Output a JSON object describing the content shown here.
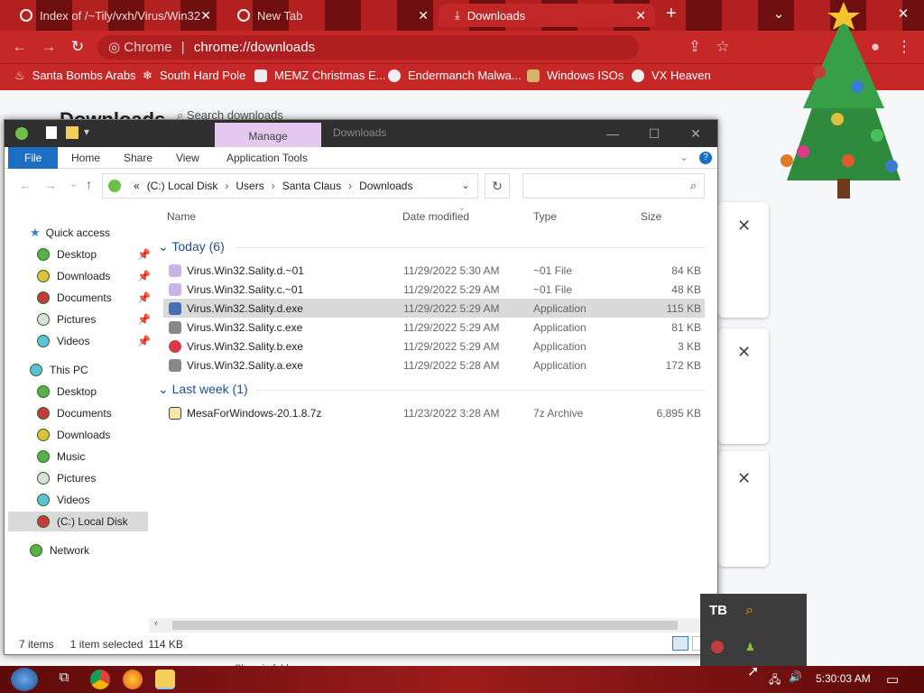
{
  "browser": {
    "tabs": [
      {
        "label": "Index of /~Tily/vxh/Virus/Win32"
      },
      {
        "label": "New Tab"
      },
      {
        "label": "Downloads"
      }
    ],
    "omnibox": {
      "site": "Chrome",
      "separator": "|",
      "url": "chrome://downloads"
    },
    "bookmarks": [
      {
        "label": "Santa Bombs Arabs"
      },
      {
        "label": "South Hard Pole"
      },
      {
        "label": "MEMZ Christmas E..."
      },
      {
        "label": "Endermanch Malwa..."
      },
      {
        "label": "Windows ISOs"
      },
      {
        "label": "VX Heaven"
      }
    ],
    "page_title": "Downloads",
    "search_placeholder": "Search downloads",
    "below_text": "Show in folder"
  },
  "explorer": {
    "manage_tab": "Manage",
    "title": "Downloads",
    "ribbon_tabs": [
      "File",
      "Home",
      "Share",
      "View",
      "Application Tools"
    ],
    "breadcrumb": [
      "«",
      "(C:) Local Disk",
      "Users",
      "Santa Claus",
      "Downloads"
    ],
    "columns": {
      "name": "Name",
      "date": "Date modified",
      "type": "Type",
      "size": "Size"
    },
    "nav": {
      "quick_access": "Quick access",
      "qa_items": [
        "Desktop",
        "Downloads",
        "Documents",
        "Pictures",
        "Videos"
      ],
      "this_pc": "This PC",
      "pc_items": [
        "Desktop",
        "Documents",
        "Downloads",
        "Music",
        "Pictures",
        "Videos",
        "(C:) Local Disk"
      ],
      "network": "Network"
    },
    "groups": [
      {
        "label": "Today (6)",
        "files": [
          {
            "name": "Virus.Win32.Sality.d.~01",
            "date": "11/29/2022 5:30 AM",
            "type": "~01 File",
            "size": "84 KB"
          },
          {
            "name": "Virus.Win32.Sality.c.~01",
            "date": "11/29/2022 5:29 AM",
            "type": "~01 File",
            "size": "48 KB"
          },
          {
            "name": "Virus.Win32.Sality.d.exe",
            "date": "11/29/2022 5:29 AM",
            "type": "Application",
            "size": "115 KB"
          },
          {
            "name": "Virus.Win32.Sality.c.exe",
            "date": "11/29/2022 5:29 AM",
            "type": "Application",
            "size": "81 KB"
          },
          {
            "name": "Virus.Win32.Sality.b.exe",
            "date": "11/29/2022 5:29 AM",
            "type": "Application",
            "size": "3 KB"
          },
          {
            "name": "Virus.Win32.Sality.a.exe",
            "date": "11/29/2022 5:28 AM",
            "type": "Application",
            "size": "172 KB"
          }
        ]
      },
      {
        "label": "Last week (1)",
        "files": [
          {
            "name": "MesaForWindows-20.1.8.7z",
            "date": "11/23/2022 3:28 AM",
            "type": "7z Archive",
            "size": "6,895 KB"
          }
        ]
      }
    ],
    "status": {
      "items": "7 items",
      "selected": "1 item selected",
      "size": "114 KB"
    }
  },
  "taskbar": {
    "clock": "5:30:03 AM"
  },
  "colors": {
    "chrome_red": "#c62828",
    "file_tab_blue": "#1a6fc4",
    "manage_purple": "#e4c8ef"
  }
}
